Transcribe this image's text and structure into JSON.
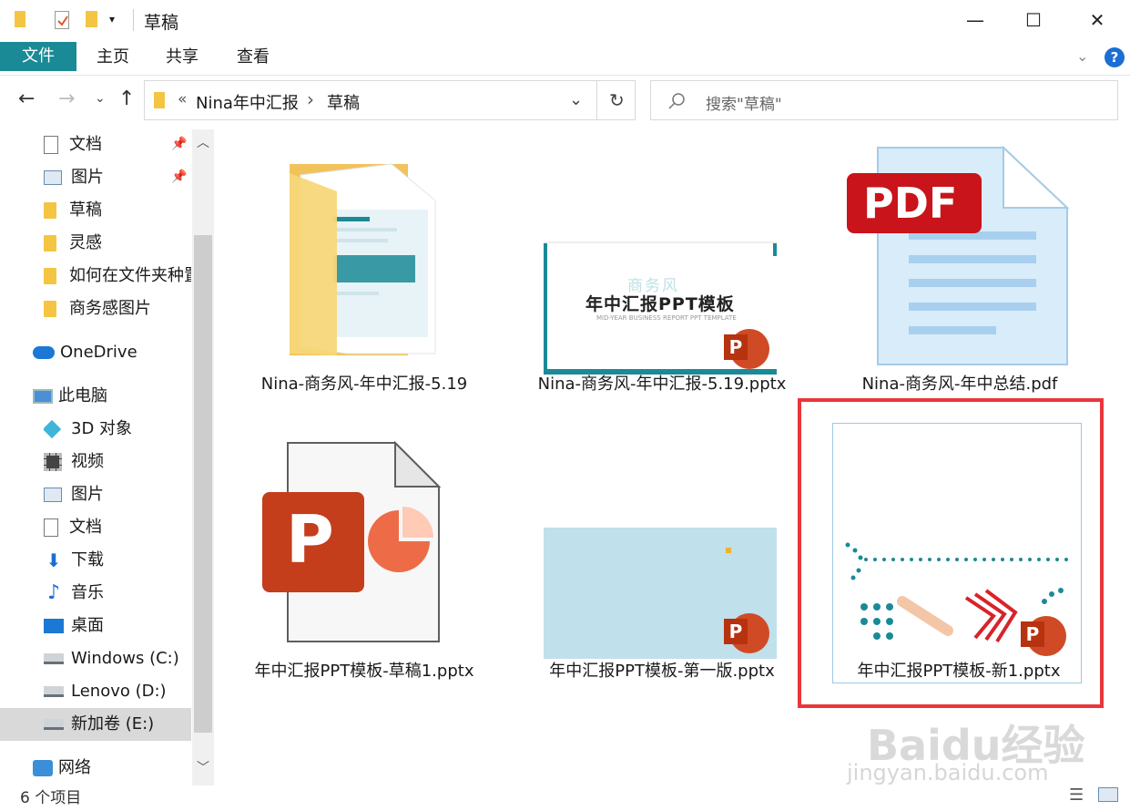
{
  "window": {
    "title": "草稿",
    "controls": {
      "minimize": "—",
      "maximize": "☐",
      "close": "✕"
    }
  },
  "ribbon": {
    "tabs": [
      "文件",
      "主页",
      "共享",
      "查看"
    ],
    "help": "?"
  },
  "address": {
    "overflow": "«",
    "crumbs": [
      "Nina年中汇报",
      "草稿"
    ],
    "separator": "›"
  },
  "search": {
    "placeholder": "搜索\"草稿\""
  },
  "sidebar": {
    "quick_access": [
      "文档",
      "图片",
      "草稿",
      "灵感",
      "如何在文件夹种置",
      "商务感图片"
    ],
    "onedrive": "OneDrive",
    "this_pc": "此电脑",
    "pc_items": [
      "3D 对象",
      "视频",
      "图片",
      "文档",
      "下载",
      "音乐",
      "桌面",
      "Windows (C:)",
      "Lenovo (D:)",
      "新加卷 (E:)"
    ],
    "network": "网络"
  },
  "files": [
    {
      "name": "Nina-商务风-年中汇报-5.19"
    },
    {
      "name": "Nina-商务风-年中汇报-5.19.pptx"
    },
    {
      "name": "Nina-商务风-年中总结.pdf"
    },
    {
      "name": "年中汇报PPT模板-草稿1.pptx"
    },
    {
      "name": "年中汇报PPT模板-第一版.pptx"
    },
    {
      "name": "年中汇报PPT模板-新1.pptx"
    }
  ],
  "thumb_text": {
    "pdf_badge": "PDF",
    "ppt_letter": "P",
    "slide_small": "商务风",
    "slide_title": "年中汇报PPT模板",
    "slide_sub": "MID-YEAR BUSINESS REPORT PPT TEMPLATE"
  },
  "status": {
    "count": "6 个项目"
  },
  "watermark": {
    "brand": "Baidu经验",
    "url": "jingyan.baidu.com"
  },
  "colors": {
    "accent": "#1a8a96",
    "highlight": "#e9363a",
    "folder": "#f4c542",
    "ppt": "#c43e1c"
  }
}
